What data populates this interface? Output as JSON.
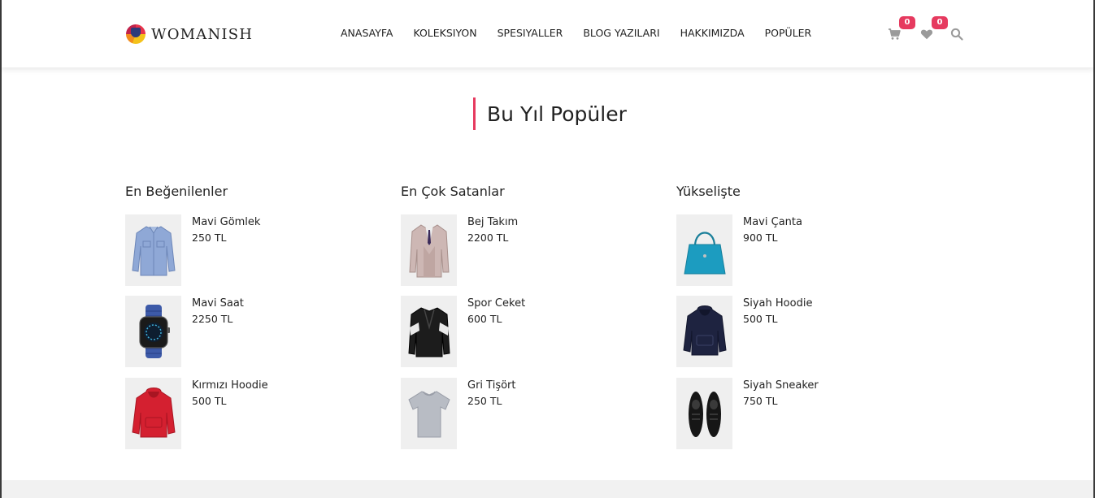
{
  "brand": {
    "name": "WOMANISH"
  },
  "nav": [
    {
      "label": "ANASAYFA"
    },
    {
      "label": "KOLEKSIYON"
    },
    {
      "label": "SPESIYALLER"
    },
    {
      "label": "BLOG YAZILARI"
    },
    {
      "label": "HAKKIMIZDA"
    },
    {
      "label": "POPÜLER"
    }
  ],
  "header_icons": {
    "cart_count": "0",
    "wishlist_count": "0",
    "accent_color": "#e63a5f"
  },
  "section": {
    "title": "Bu Yıl Popüler"
  },
  "columns": [
    {
      "title": "En Beğenilenler",
      "items": [
        {
          "name": "Mavi Gömlek",
          "price": "250 TL",
          "icon": "blue-shirt-icon"
        },
        {
          "name": "Mavi Saat",
          "price": "2250 TL",
          "icon": "blue-watch-icon"
        },
        {
          "name": "Kırmızı Hoodie",
          "price": "500 TL",
          "icon": "red-hoodie-icon"
        }
      ]
    },
    {
      "title": "En Çok Satanlar",
      "items": [
        {
          "name": "Bej Takım",
          "price": "2200 TL",
          "icon": "beige-suit-icon"
        },
        {
          "name": "Spor Ceket",
          "price": "600 TL",
          "icon": "sport-jacket-icon"
        },
        {
          "name": "Gri Tişört",
          "price": "250 TL",
          "icon": "grey-tshirt-icon"
        }
      ]
    },
    {
      "title": "Yükselişte",
      "items": [
        {
          "name": "Mavi Çanta",
          "price": "900 TL",
          "icon": "blue-bag-icon"
        },
        {
          "name": "Siyah Hoodie",
          "price": "500 TL",
          "icon": "black-hoodie-icon"
        },
        {
          "name": "Siyah Sneaker",
          "price": "750 TL",
          "icon": "black-sneaker-icon"
        }
      ]
    }
  ]
}
